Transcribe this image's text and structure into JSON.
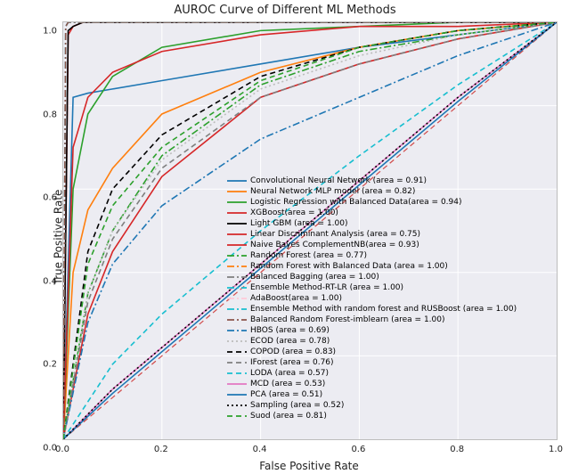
{
  "chart_data": {
    "type": "line",
    "title": "AUROC Curve of Different ML Methods",
    "xlabel": "False Positive Rate",
    "ylabel": "True Positive Rate",
    "xlim": [
      0.0,
      1.0
    ],
    "ylim": [
      0.0,
      1.0
    ],
    "x_ticks": [
      "0.0",
      "0.2",
      "0.4",
      "0.6",
      "0.8",
      "1.0"
    ],
    "y_ticks": [
      "0.0",
      "0.2",
      "0.4",
      "0.6",
      "0.8",
      "1.0"
    ],
    "diagonal": {
      "color": "#d14a4a",
      "style": "dashed",
      "points": [
        [
          0,
          0
        ],
        [
          1,
          1
        ]
      ]
    },
    "series": [
      {
        "name": "Convolutional Neural Network",
        "area": 0.91,
        "color": "#1f77b4",
        "style": "solid",
        "x": [
          0.0,
          0.02,
          0.05,
          0.1,
          0.2,
          0.4,
          0.6,
          0.8,
          1.0
        ],
        "y": [
          0.0,
          0.82,
          0.83,
          0.84,
          0.86,
          0.9,
          0.94,
          0.97,
          1.0
        ]
      },
      {
        "name": "Neural Network MLP model",
        "area": 0.82,
        "color": "#ff7f0e",
        "style": "solid",
        "x": [
          0.0,
          0.02,
          0.05,
          0.1,
          0.2,
          0.4,
          0.6,
          0.8,
          1.0
        ],
        "y": [
          0.0,
          0.4,
          0.55,
          0.65,
          0.78,
          0.88,
          0.94,
          0.98,
          1.0
        ]
      },
      {
        "name": "Logistic Regression with Balanced Data",
        "area": 0.94,
        "color": "#2ca02c",
        "style": "solid",
        "x": [
          0.0,
          0.02,
          0.05,
          0.1,
          0.2,
          0.4,
          0.6,
          0.8,
          1.0
        ],
        "y": [
          0.0,
          0.6,
          0.78,
          0.87,
          0.94,
          0.98,
          0.99,
          1.0,
          1.0
        ]
      },
      {
        "name": "XGBoost",
        "area": 1.0,
        "color": "#d62728",
        "style": "solid",
        "x": [
          0.0,
          0.01,
          0.02,
          0.04,
          0.08,
          0.2,
          0.5,
          1.0
        ],
        "y": [
          0.0,
          0.97,
          0.99,
          1.0,
          1.0,
          1.0,
          1.0,
          1.0
        ]
      },
      {
        "name": "Light GBM",
        "area": 1.0,
        "color": "#000000",
        "style": "solid",
        "x": [
          0.0,
          0.01,
          0.02,
          0.04,
          0.08,
          0.2,
          0.5,
          1.0
        ],
        "y": [
          0.0,
          0.98,
          0.99,
          1.0,
          1.0,
          1.0,
          1.0,
          1.0
        ]
      },
      {
        "name": "Linear Discriminant Analysis",
        "area": 0.75,
        "color": "#d62728",
        "style": "solid",
        "x": [
          0.0,
          0.05,
          0.1,
          0.2,
          0.4,
          0.6,
          0.8,
          1.0
        ],
        "y": [
          0.0,
          0.3,
          0.45,
          0.63,
          0.82,
          0.9,
          0.96,
          1.0
        ]
      },
      {
        "name": "Naive Bayes ComplementNB",
        "area": 0.93,
        "color": "#d62728",
        "style": "solid",
        "x": [
          0.0,
          0.02,
          0.05,
          0.1,
          0.2,
          0.4,
          0.6,
          0.8,
          1.0
        ],
        "y": [
          0.0,
          0.7,
          0.82,
          0.88,
          0.93,
          0.97,
          0.99,
          0.99,
          1.0
        ]
      },
      {
        "name": "Random Forest",
        "area": 0.77,
        "color": "#2ca02c",
        "style": "dashdot",
        "x": [
          0.0,
          0.05,
          0.1,
          0.2,
          0.4,
          0.6,
          0.8,
          1.0
        ],
        "y": [
          0.0,
          0.35,
          0.5,
          0.68,
          0.85,
          0.93,
          0.97,
          1.0
        ]
      },
      {
        "name": "Random Forest with Balanced Data",
        "area": 1.0,
        "color": "#ff7f0e",
        "style": "dashdot",
        "x": [
          0.0,
          0.005,
          0.01,
          0.05,
          0.2,
          1.0
        ],
        "y": [
          0.0,
          0.99,
          1.0,
          1.0,
          1.0,
          1.0
        ]
      },
      {
        "name": "Balanced Bagging",
        "area": 1.0,
        "color": "#7f7f7f",
        "style": "dashdot",
        "x": [
          0.0,
          0.005,
          0.01,
          0.05,
          0.2,
          1.0
        ],
        "y": [
          0.0,
          0.99,
          1.0,
          1.0,
          1.0,
          1.0
        ]
      },
      {
        "name": "Ensemble Method-RT-LR",
        "area": 1.0,
        "color": "#17becf",
        "style": "dashdot",
        "x": [
          0.0,
          0.005,
          0.01,
          0.05,
          0.2,
          1.0
        ],
        "y": [
          0.0,
          0.99,
          1.0,
          1.0,
          1.0,
          1.0
        ]
      },
      {
        "name": "AdaBoost",
        "area": 1.0,
        "color": "#ffc9d8",
        "style": "dashdot",
        "x": [
          0.0,
          0.005,
          0.01,
          0.05,
          0.2,
          1.0
        ],
        "y": [
          0.0,
          0.99,
          1.0,
          1.0,
          1.0,
          1.0
        ]
      },
      {
        "name": "Ensemble Method with random forest and RUSBoost",
        "area": 1.0,
        "color": "#17becf",
        "style": "dashdot",
        "x": [
          0.0,
          0.005,
          0.01,
          0.05,
          0.2,
          1.0
        ],
        "y": [
          0.0,
          0.99,
          1.0,
          1.0,
          1.0,
          1.0
        ]
      },
      {
        "name": "Balanced Random Forest-imblearn",
        "area": 1.0,
        "color": "#8c564b",
        "style": "dashdot",
        "x": [
          0.0,
          0.005,
          0.01,
          0.05,
          0.2,
          1.0
        ],
        "y": [
          0.0,
          0.99,
          1.0,
          1.0,
          1.0,
          1.0
        ]
      },
      {
        "name": "HBOS",
        "area": 0.69,
        "color": "#1f77b4",
        "style": "dashdot",
        "x": [
          0.0,
          0.05,
          0.1,
          0.2,
          0.4,
          0.6,
          0.8,
          1.0
        ],
        "y": [
          0.0,
          0.28,
          0.42,
          0.56,
          0.72,
          0.82,
          0.92,
          1.0
        ]
      },
      {
        "name": "ECOD",
        "area": 0.78,
        "color": "#bcbcbc",
        "style": "dotted",
        "x": [
          0.0,
          0.05,
          0.1,
          0.2,
          0.4,
          0.6,
          0.8,
          1.0
        ],
        "y": [
          0.0,
          0.35,
          0.5,
          0.67,
          0.84,
          0.92,
          0.97,
          1.0
        ]
      },
      {
        "name": "COPOD",
        "area": 0.83,
        "color": "#000000",
        "style": "dashed",
        "x": [
          0.0,
          0.05,
          0.1,
          0.2,
          0.4,
          0.6,
          0.8,
          1.0
        ],
        "y": [
          0.0,
          0.45,
          0.6,
          0.73,
          0.87,
          0.94,
          0.98,
          1.0
        ]
      },
      {
        "name": "IForest",
        "area": 0.76,
        "color": "#7f7f7f",
        "style": "dashed",
        "x": [
          0.0,
          0.05,
          0.1,
          0.2,
          0.4,
          0.6,
          0.8,
          1.0
        ],
        "y": [
          0.0,
          0.33,
          0.48,
          0.65,
          0.82,
          0.9,
          0.96,
          1.0
        ]
      },
      {
        "name": "LODA",
        "area": 0.57,
        "color": "#17becf",
        "style": "dashed",
        "x": [
          0.0,
          0.1,
          0.2,
          0.4,
          0.6,
          0.8,
          1.0
        ],
        "y": [
          0.0,
          0.18,
          0.3,
          0.5,
          0.68,
          0.85,
          1.0
        ]
      },
      {
        "name": "MCD",
        "area": 0.53,
        "color": "#e377c2",
        "style": "solid",
        "x": [
          0.0,
          0.1,
          0.2,
          0.4,
          0.6,
          0.8,
          1.0
        ],
        "y": [
          0.0,
          0.12,
          0.22,
          0.42,
          0.62,
          0.82,
          1.0
        ]
      },
      {
        "name": "PCA",
        "area": 0.51,
        "color": "#1f77b4",
        "style": "solid",
        "x": [
          0.0,
          0.1,
          0.2,
          0.4,
          0.6,
          0.8,
          1.0
        ],
        "y": [
          0.0,
          0.11,
          0.21,
          0.41,
          0.61,
          0.81,
          1.0
        ]
      },
      {
        "name": "Sampling",
        "area": 0.52,
        "color": "#000000",
        "style": "dotted",
        "x": [
          0.0,
          0.1,
          0.2,
          0.4,
          0.6,
          0.8,
          1.0
        ],
        "y": [
          0.0,
          0.12,
          0.22,
          0.42,
          0.62,
          0.82,
          1.0
        ]
      },
      {
        "name": "Suod",
        "area": 0.81,
        "color": "#2ca02c",
        "style": "dashed",
        "x": [
          0.0,
          0.05,
          0.1,
          0.2,
          0.4,
          0.6,
          0.8,
          1.0
        ],
        "y": [
          0.0,
          0.42,
          0.56,
          0.7,
          0.86,
          0.94,
          0.98,
          1.0
        ]
      }
    ],
    "legend_labels": [
      "Convolutional Neural Network (area = 0.91)",
      " Neural Network MLP model (area = 0.82)",
      "Logistic Regression with Balanced Data(area = 0.94)",
      "XGBoost(area = 1.00)",
      "Light GBM (area = 1.00)",
      "Linear Discriminant Analysis  (area = 0.75)",
      "Naive Bayes ComplementNB(area = 0.93)",
      "Random Forest (area = 0.77)",
      "Random Forest with Balanced Data (area = 1.00)",
      "Balanced Bagging  (area = 1.00)",
      "Ensemble Method-RT-LR  (area = 1.00)",
      "AdaBoost(area = 1.00)",
      "Ensemble Method with random forest and RUSBoost (area = 1.00)",
      "Balanced Random Forest-imblearn (area = 1.00)",
      "HBOS (area = 0.69)",
      "ECOD (area = 0.78)",
      "COPOD (area = 0.83)",
      "IForest (area = 0.76)",
      "LODA (area = 0.57)",
      "MCD (area = 0.53)",
      "PCA (area = 0.51)",
      "Sampling (area = 0.52)",
      "Suod (area = 0.81)"
    ]
  }
}
